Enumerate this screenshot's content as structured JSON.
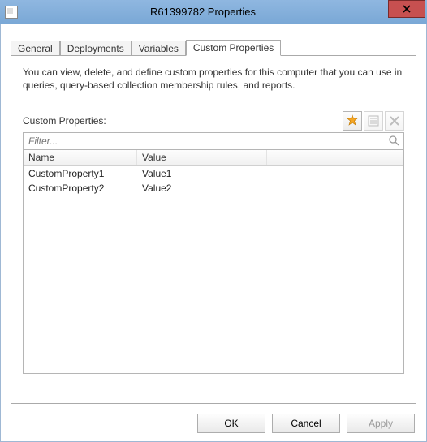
{
  "window": {
    "title": "R61399782 Properties"
  },
  "tabs": {
    "general": "General",
    "deployments": "Deployments",
    "variables": "Variables",
    "custom": "Custom Properties"
  },
  "description": "You can view, delete, and define custom properties for this computer that you can use in queries, query-based collection membership rules, and reports.",
  "section_label": "Custom Properties:",
  "filter": {
    "placeholder": "Filter..."
  },
  "columns": {
    "name": "Name",
    "value": "Value"
  },
  "rows": [
    {
      "name": "CustomProperty1",
      "value": "Value1"
    },
    {
      "name": "CustomProperty2",
      "value": "Value2"
    }
  ],
  "buttons": {
    "ok": "OK",
    "cancel": "Cancel",
    "apply": "Apply"
  },
  "icons": {
    "new": "new-icon",
    "properties": "properties-icon",
    "delete": "delete-icon",
    "search": "search-icon",
    "close": "close-icon",
    "system": "system-icon"
  }
}
